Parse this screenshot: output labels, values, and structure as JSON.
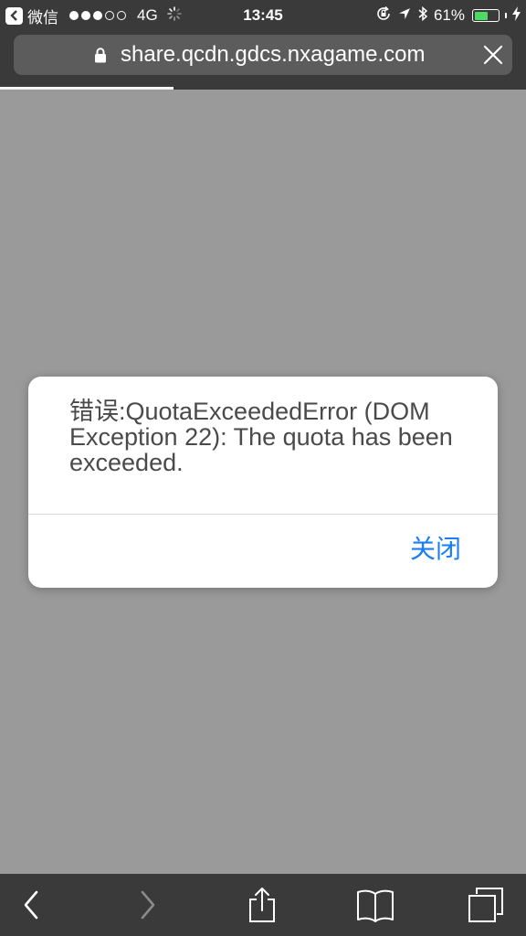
{
  "status_bar": {
    "app_name": "微信",
    "signal_dots": [
      true,
      true,
      true,
      false,
      false
    ],
    "network": "4G",
    "time": "13:45",
    "battery_percent_text": "61%",
    "battery_level": 0.61,
    "battery_color": "#4cd964"
  },
  "browser": {
    "url": "share.qcdn.gdcs.nxagame.com",
    "load_progress": 0.33
  },
  "alert": {
    "message": "错误:QuotaExceededError (DOM Exception 22): The quota has been exceeded.",
    "close_label": "关闭",
    "button_color": "#1a7ff5"
  },
  "toolbar": {
    "icons": [
      "back-icon",
      "forward-icon",
      "share-icon",
      "bookmarks-icon",
      "tabs-icon"
    ]
  }
}
